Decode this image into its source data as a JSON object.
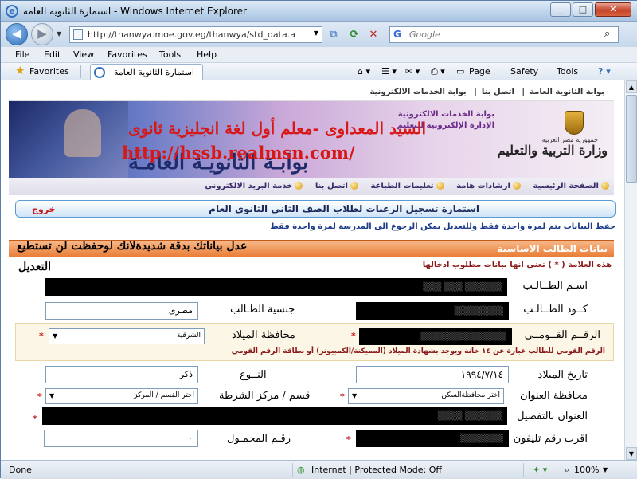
{
  "window": {
    "title": "استمارة الثانوية العامة - Windows Internet Explorer"
  },
  "nav": {
    "url": "http://thanwya.moe.gov.eg/thanwya/std_data.a",
    "search_placeholder": "Google"
  },
  "menu": [
    "File",
    "Edit",
    "View",
    "Favorites",
    "Tools",
    "Help"
  ],
  "favorites_label": "Favorites",
  "tab_title": "استمارة الثانوية العامة",
  "commands": {
    "page": "Page",
    "safety": "Safety",
    "tools": "Tools"
  },
  "portal": {
    "top_links": [
      "بوابة الثانوية العامة",
      "اتصل بنا",
      "بوابة الخدمات الالكترونية"
    ],
    "banner_title": "بوابـة الثانويـة العامـة",
    "banner_ad_line1": "السيد المعداوى -معلم أول لغة انجليزية ثانوى",
    "banner_ad_line2": "http://hssb.realmsn.com/",
    "banner_portal_line1": "بوابة الخدمات الالكترونية",
    "banner_portal_line2": "الإدارة الإلكترونية للتعليم",
    "banner_ministry": "وزارة التربية والتعليم",
    "banner_republic": "جمهورية مصر العربية",
    "site_nav": [
      "الصفحة الرئيسية",
      "ارشادات هامة",
      "تعليمات الطباعة",
      "اتصل بنا",
      "خدمة البريد الالكترونى"
    ]
  },
  "form": {
    "header": "استمارة تسجيل الرغبات لطلاب الصف الثانى الثانوى العام",
    "logout": "خروج",
    "save_note": "حفظ البيانات يتم لمرة واحدة فقط وللتعديل يمكن الرجوع الى المدرسة لمرة واحدة فقط",
    "section_title": "بيانات الطالب الاساسية",
    "overlay_warning": "عدل بياناتك بدقة شديدةلانك لوحفظت لن تستطيع",
    "edit_word": "التعديل",
    "required_note": "هذه العلامة ( * ) تعنى انها بيانات مطلوب ادخالها",
    "fields": {
      "name_label": "اسـم الطــالـب",
      "name_value": "▒▒▒▒▒▒ ▒▒▒ ▒▒▒",
      "code_label": "كــود الطــالـب",
      "code_value": "▒▒▒▒▒▒▒▒",
      "nationality_label": "جنسية الطـالب",
      "nationality_value": "مصرى",
      "national_id_label": "الرقــم القــومــى",
      "national_id_value": "▒▒▒▒▒▒▒▒▒▒▒▒▒▒",
      "birth_gov_label": "محافظة الميلاد",
      "birth_gov_value": "الشرقية",
      "national_id_help": "الرقم القومي للطالب عبارة عن ١٤ خانة ويوجد بشهادة الميلاد (المميكنة/الكمبيوتر) أو بطاقة الرقم القومي",
      "birth_date_label": "تاريخ الميلاد",
      "birth_date_value": "١٩٩٤/٧/١٤",
      "gender_label": "النــوع",
      "gender_value": "ذكر",
      "address_gov_label": "محافظة العنوان",
      "address_gov_value": "اختر محافظةالسكن",
      "district_label": "قسم / مركز الشرطة",
      "district_value": "اختر القسم / المركز",
      "address_label": "العنوان بالتفصيل",
      "address_value": "▒▒▒▒▒▒ ▒▒▒▒",
      "phone_label": "اقرب رقم تليفون",
      "phone_value": "▒▒▒▒▒▒▒",
      "mobile_label": "رقـم المحمـول",
      "mobile_value": "٠"
    }
  },
  "status": {
    "left": "Done",
    "zone": "Internet | Protected Mode: Off",
    "zoom": "100%"
  }
}
